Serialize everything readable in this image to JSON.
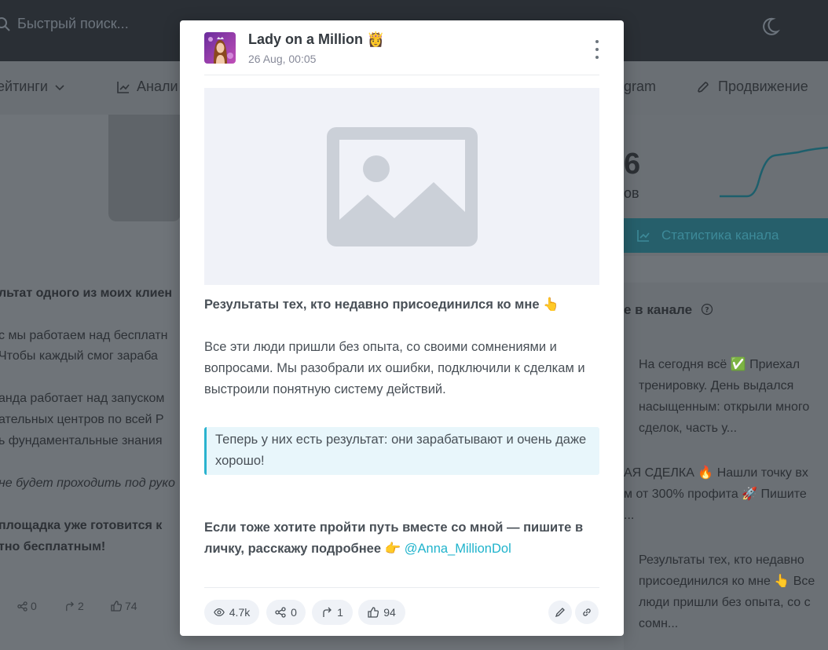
{
  "background": {
    "search_placeholder": "Быстрый поиск...",
    "nav": [
      "ейтинги",
      "Анали",
      "gram",
      "Продвижение"
    ],
    "left_lines": [
      {
        "text": "льтат одного из моих клиен",
        "style": "b"
      },
      {
        "text": "с мы работаем над бесплатн",
        "style": ""
      },
      {
        "text": "Чтобы каждый смог зараба",
        "style": ""
      },
      {
        "text": "анда работает над запуском",
        "style": ""
      },
      {
        "text": "ательных центров по всей Р",
        "style": ""
      },
      {
        "text": "ь фундаментальные знания",
        "style": ""
      },
      {
        "text": "не будет проходить под руко",
        "style": "i"
      },
      {
        "text": "площадка уже готовится к",
        "style": "b"
      },
      {
        "text": "тно бесплатным!",
        "style": "b"
      }
    ],
    "left_stats": {
      "shares": "0",
      "forwards": "2",
      "likes": "74"
    },
    "big_number": "6",
    "subs_suffix": "ов",
    "stat_button": "Статистика канала",
    "right_title": "е в канале",
    "right_posts": [
      [
        "На сегодня всё ✅ Приехал",
        "тренировку. День выдался",
        "насыщенным: открыли много",
        "сделок, часть у..."
      ],
      [
        "АЯ СДЕЛКА 🔥 Нашли точку вх",
        "м от 300% профита 🚀 Пишите",
        "..."
      ],
      [
        "Результаты тех, кто недавно",
        "присоединился ко мне 👆 Все",
        "люди пришли без опыта, со с",
        "сомн..."
      ]
    ]
  },
  "post": {
    "channel_name": "Lady on a Million 👸",
    "date": "26 Aug, 00:05",
    "headline": "Результаты тех, кто недавно присоединился ко мне 👆",
    "paragraph": "Все эти люди пришли без опыта, со своими сомнениями и вопросами. Мы разобрали их ошибки, подключили к сделкам и выстроили понятную систему действий.",
    "quote": "Теперь у них есть результат: они зарабатывают и очень даже хорошо!",
    "cta": "Если тоже хотите пройти путь вместе со мной — пишите в личку, расскажу подробнее 👉",
    "mention": "@Anna_MillionDol",
    "stats": {
      "views": "4.7k",
      "shares": "0",
      "forwards": "1",
      "likes": "94"
    }
  },
  "colors": {
    "accent": "#2ab3cf",
    "mention": "#1fb3cc",
    "pill_bg": "#eff2f7"
  },
  "icons": [
    "search-icon",
    "moon-icon",
    "eye-icon",
    "share-icon",
    "forward-icon",
    "like-icon",
    "edit-icon",
    "link-icon",
    "more-icon",
    "image-placeholder-icon"
  ]
}
